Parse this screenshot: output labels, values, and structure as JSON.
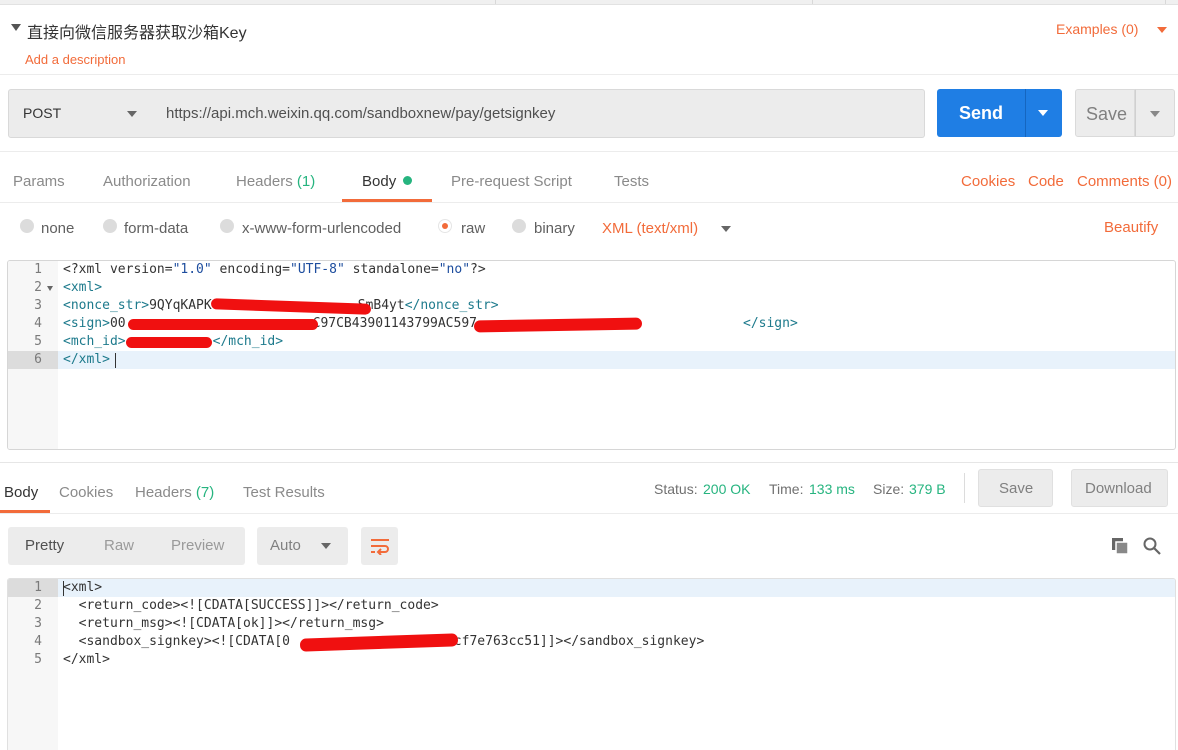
{
  "request": {
    "title": "直接向微信服务器获取沙箱Key",
    "add_description": "Add a description",
    "examples": "Examples (0)",
    "method": "POST",
    "url": "https://api.mch.weixin.qq.com/sandboxnew/pay/getsignkey",
    "send": "Send",
    "save": "Save"
  },
  "tabs": {
    "params": "Params",
    "authorization": "Authorization",
    "headers": "Headers",
    "headers_count": "(1)",
    "body": "Body",
    "prerequest": "Pre-request Script",
    "tests": "Tests",
    "cookies": "Cookies",
    "code": "Code",
    "comments": "Comments (0)"
  },
  "body_options": {
    "none": "none",
    "form_data": "form-data",
    "urlencoded": "x-www-form-urlencoded",
    "raw": "raw",
    "binary": "binary",
    "content_type": "XML (text/xml)",
    "beautify": "Beautify"
  },
  "request_body": {
    "line_numbers": [
      "1",
      "2",
      "3",
      "4",
      "5",
      "6"
    ],
    "lines": {
      "l1a": "<?xml version=",
      "l1b": "\"1.0\"",
      "l1c": " encoding=",
      "l1d": "\"UTF-8\"",
      "l1e": " standalone=",
      "l1f": "\"no\"",
      "l1g": "?>",
      "l2": "<xml>",
      "l3a": "<nonce_str>",
      "l3b": "9QYqKAPK",
      "l3c": "SmB4yt",
      "l3d": "</nonce_str>",
      "l4a": "<sign>",
      "l4b": "00",
      "l4c": "C97CB43901143799AC597",
      "l4d": "</sign>",
      "l5a": "<mch_id>",
      "l5b": "</mch_id>",
      "l6": "</xml>"
    }
  },
  "response": {
    "tabs": {
      "body": "Body",
      "cookies": "Cookies",
      "headers": "Headers",
      "headers_count": "(7)",
      "test_results": "Test Results"
    },
    "status_label": "Status:",
    "status_value": "200 OK",
    "time_label": "Time:",
    "time_value": "133 ms",
    "size_label": "Size:",
    "size_value": "379 B",
    "save": "Save",
    "download": "Download",
    "view": {
      "pretty": "Pretty",
      "raw": "Raw",
      "preview": "Preview",
      "format": "Auto"
    },
    "line_numbers": [
      "1",
      "2",
      "3",
      "4",
      "5"
    ],
    "lines": {
      "l1": "<xml>",
      "l2": "  <return_code><![CDATA[SUCCESS]]></return_code>",
      "l3": "  <return_msg><![CDATA[ok]]></return_msg>",
      "l4a": "  <sandbox_signkey><![CDATA[0",
      "l4b": "2cf7e763cc51]]></sandbox_signkey>",
      "l5": "</xml>"
    }
  },
  "icons": [
    "caret-down-icon",
    "dropdown-arrow-icon",
    "wrap-lines-icon",
    "copy-icon",
    "search-icon"
  ],
  "colors": {
    "accent": "#f26b3a",
    "send": "#1f7ee4",
    "success": "#26b47f"
  }
}
